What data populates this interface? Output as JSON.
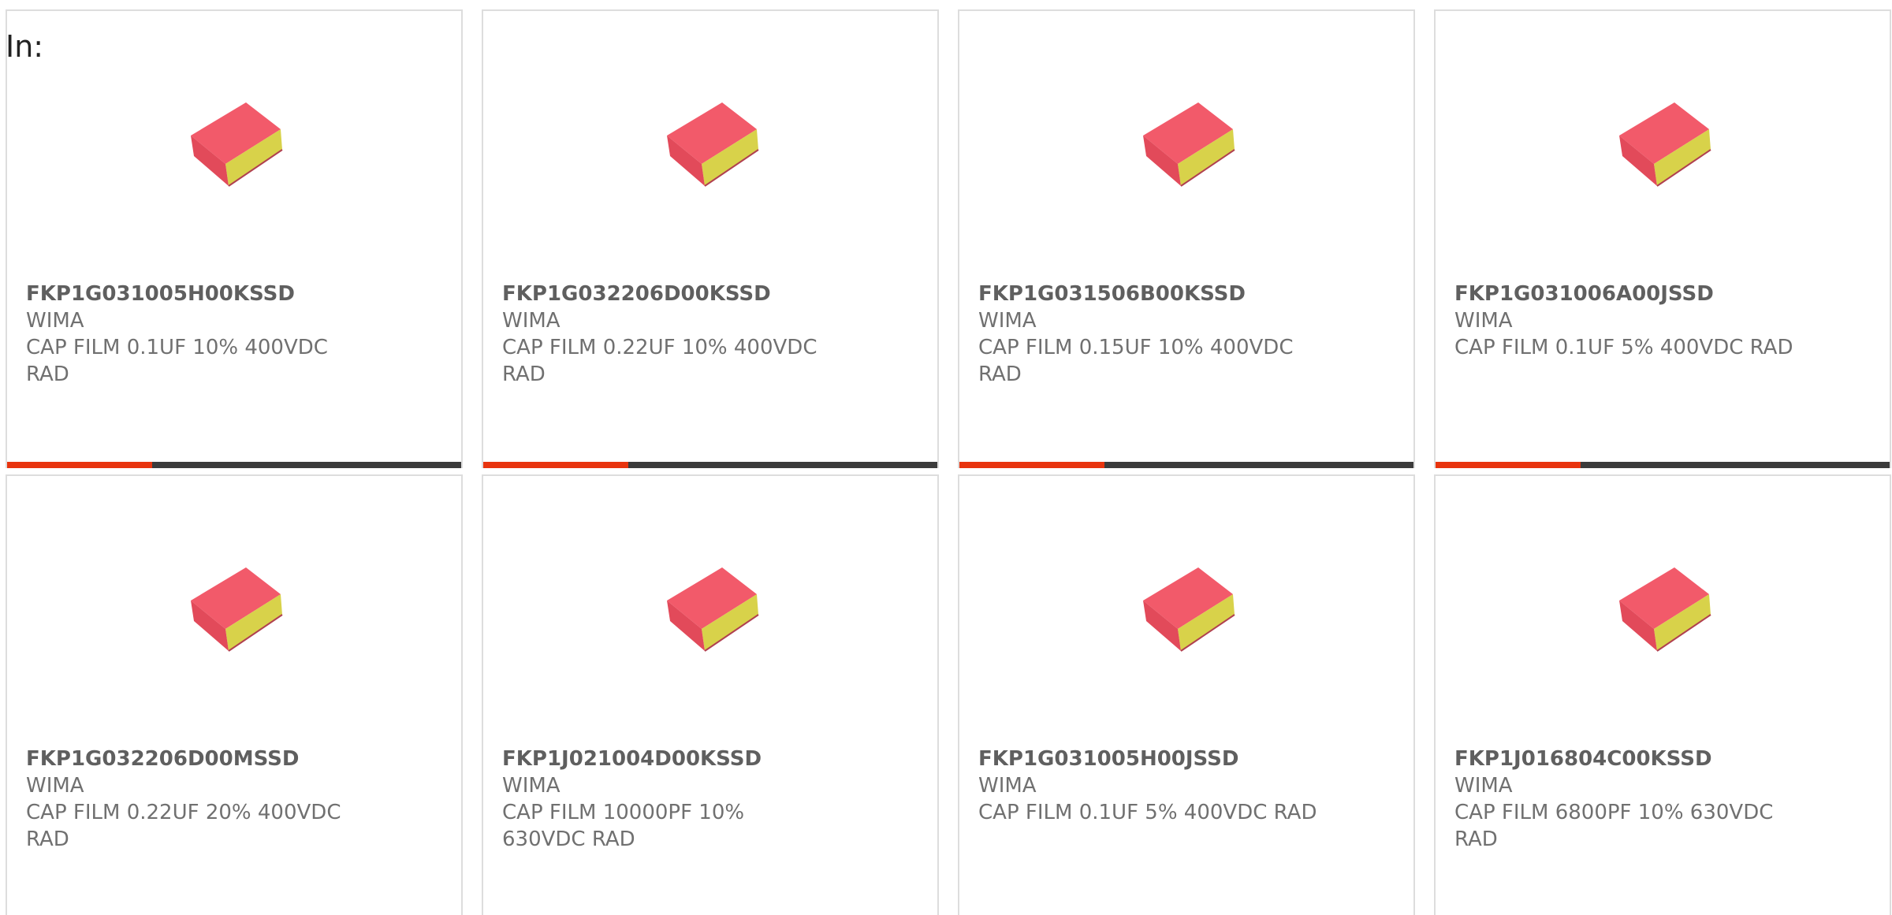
{
  "header": {
    "in_label": "In:"
  },
  "colors": {
    "accent": "#e8340e",
    "bar_track": "#3b3b3b",
    "capacitor_body": "#f25a6a",
    "capacitor_side": "#d8d24a"
  },
  "products": [
    {
      "part": "FKP1G031005H00KSSD",
      "maker": "WIMA",
      "desc": "CAP FILM 0.1UF 10% 400VDC RAD",
      "icon": "capacitor-image",
      "progress": 0.32
    },
    {
      "part": "FKP1G032206D00KSSD",
      "maker": "WIMA",
      "desc": "CAP FILM 0.22UF 10% 400VDC RAD",
      "icon": "capacitor-image",
      "progress": 0.32
    },
    {
      "part": "FKP1G031506B00KSSD",
      "maker": "WIMA",
      "desc": "CAP FILM 0.15UF 10% 400VDC RAD",
      "icon": "capacitor-image",
      "progress": 0.32
    },
    {
      "part": "FKP1G031006A00JSSD",
      "maker": "WIMA",
      "desc": "CAP FILM 0.1UF 5% 400VDC RAD",
      "icon": "capacitor-image",
      "progress": 0.32
    },
    {
      "part": "FKP1G032206D00MSSD",
      "maker": "WIMA",
      "desc": "CAP FILM 0.22UF 20% 400VDC RAD",
      "icon": "capacitor-image"
    },
    {
      "part": "FKP1J021004D00KSSD",
      "maker": "WIMA",
      "desc": "CAP FILM 10000PF 10% 630VDC RAD",
      "icon": "capacitor-image"
    },
    {
      "part": "FKP1G031005H00JSSD",
      "maker": "WIMA",
      "desc": "CAP FILM 0.1UF 5% 400VDC RAD",
      "icon": "capacitor-image"
    },
    {
      "part": "FKP1J016804C00KSSD",
      "maker": "WIMA",
      "desc": "CAP FILM 6800PF 10% 630VDC RAD",
      "icon": "capacitor-image"
    }
  ]
}
